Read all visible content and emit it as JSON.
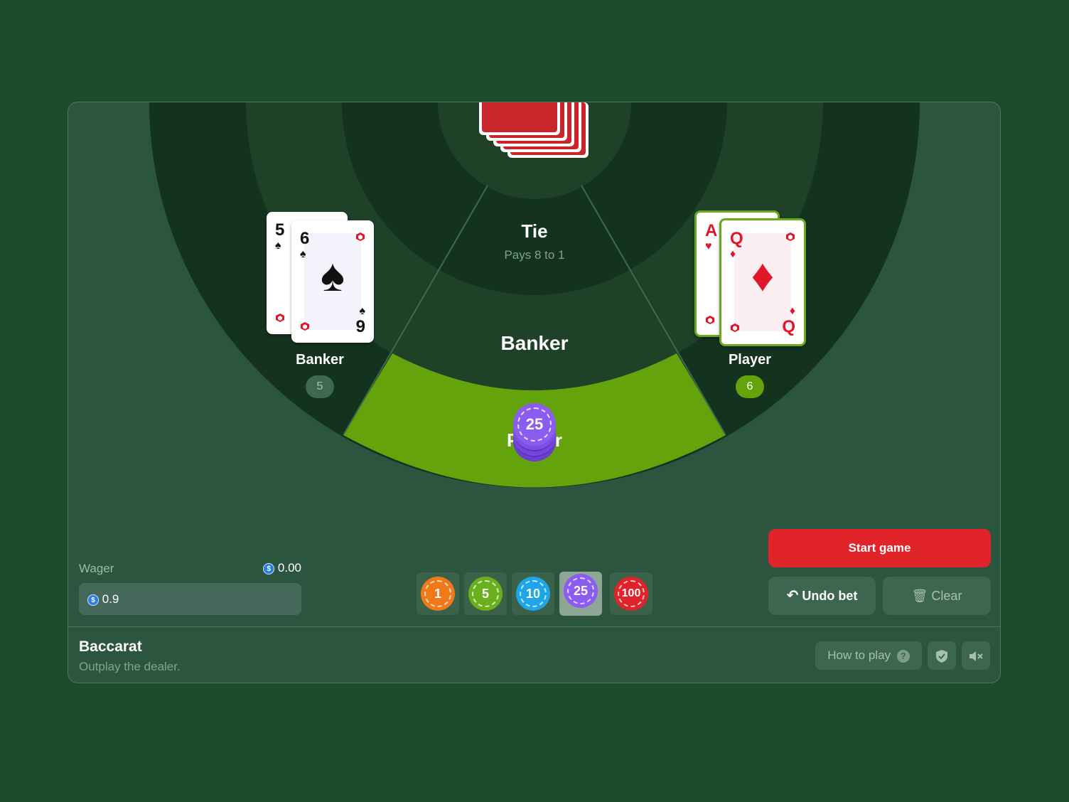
{
  "game": {
    "title": "Baccarat",
    "subtitle": "Outplay the dealer."
  },
  "zones": {
    "tie_label": "Tie",
    "tie_payout": "Pays 8 to 1",
    "banker_label": "Banker",
    "player_label": "Player"
  },
  "hands": {
    "banker": {
      "label": "Banker",
      "count": "5",
      "cards": [
        {
          "rank": "5",
          "suit": "♠",
          "color": "black"
        },
        {
          "rank": "6",
          "suit": "♠",
          "color": "black",
          "bottom_rank": "9"
        }
      ]
    },
    "player": {
      "label": "Player",
      "count": "6",
      "cards": [
        {
          "rank": "A",
          "suit": "♥",
          "color": "red"
        },
        {
          "rank": "Q",
          "suit": "♦",
          "color": "red",
          "bottom_rank": "Q"
        }
      ]
    }
  },
  "bet_stack": {
    "chip_value": "25",
    "on_zone": "Player"
  },
  "wager": {
    "label": "Wager",
    "balance": "0.00",
    "amount": "0.9",
    "currency_icon": "usdc-coin-icon"
  },
  "chips": [
    {
      "value": "1",
      "color": "#f07a1a",
      "selected": false
    },
    {
      "value": "5",
      "color": "#69b01c",
      "selected": false
    },
    {
      "value": "10",
      "color": "#1ea6e8",
      "selected": false
    },
    {
      "value": "25",
      "color": "#8b5cf0",
      "selected": true
    },
    {
      "value": "100",
      "color": "#e0222a",
      "selected": false
    }
  ],
  "actions": {
    "start_label": "Start game",
    "undo_label": "Undo bet",
    "clear_label": "Clear",
    "how_to_play_label": "How to play"
  },
  "colors": {
    "background": "#1d4a2b",
    "panel": "#2c5540",
    "start_button": "#e0242a",
    "player_zone_highlight": "#65a30d",
    "card_back": "#c8262a"
  }
}
